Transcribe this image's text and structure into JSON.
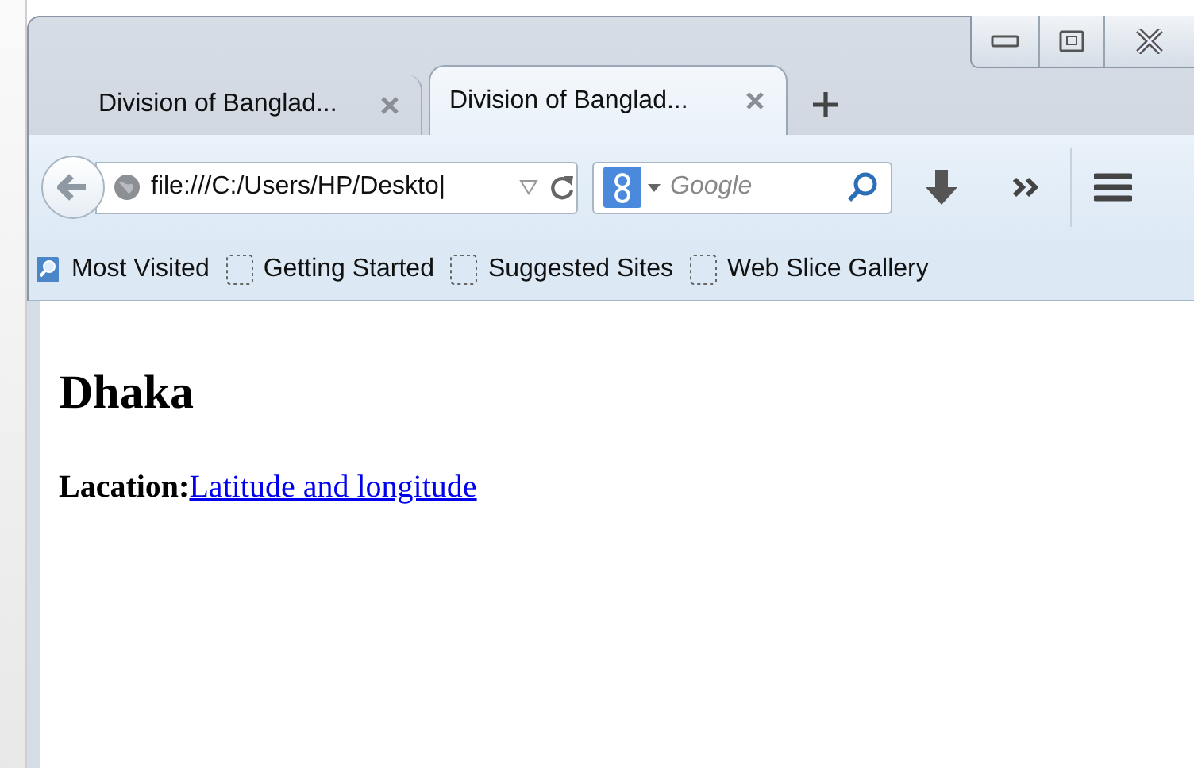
{
  "tabs": [
    {
      "label": "Division of Banglad...",
      "selected": false
    },
    {
      "label": "Division of Banglad...",
      "selected": true
    }
  ],
  "toolbar": {
    "address": "file:///C:/Users/HP/Deskto|",
    "search_placeholder": "Google"
  },
  "bookmarks": [
    {
      "label": "Most Visited",
      "kind": "smart"
    },
    {
      "label": "Getting Started",
      "kind": "page"
    },
    {
      "label": "Suggested Sites",
      "kind": "page"
    },
    {
      "label": "Web Slice Gallery",
      "kind": "page"
    }
  ],
  "page": {
    "heading": "Dhaka",
    "label": "Lacation:",
    "link": "Latitude and longitude"
  }
}
